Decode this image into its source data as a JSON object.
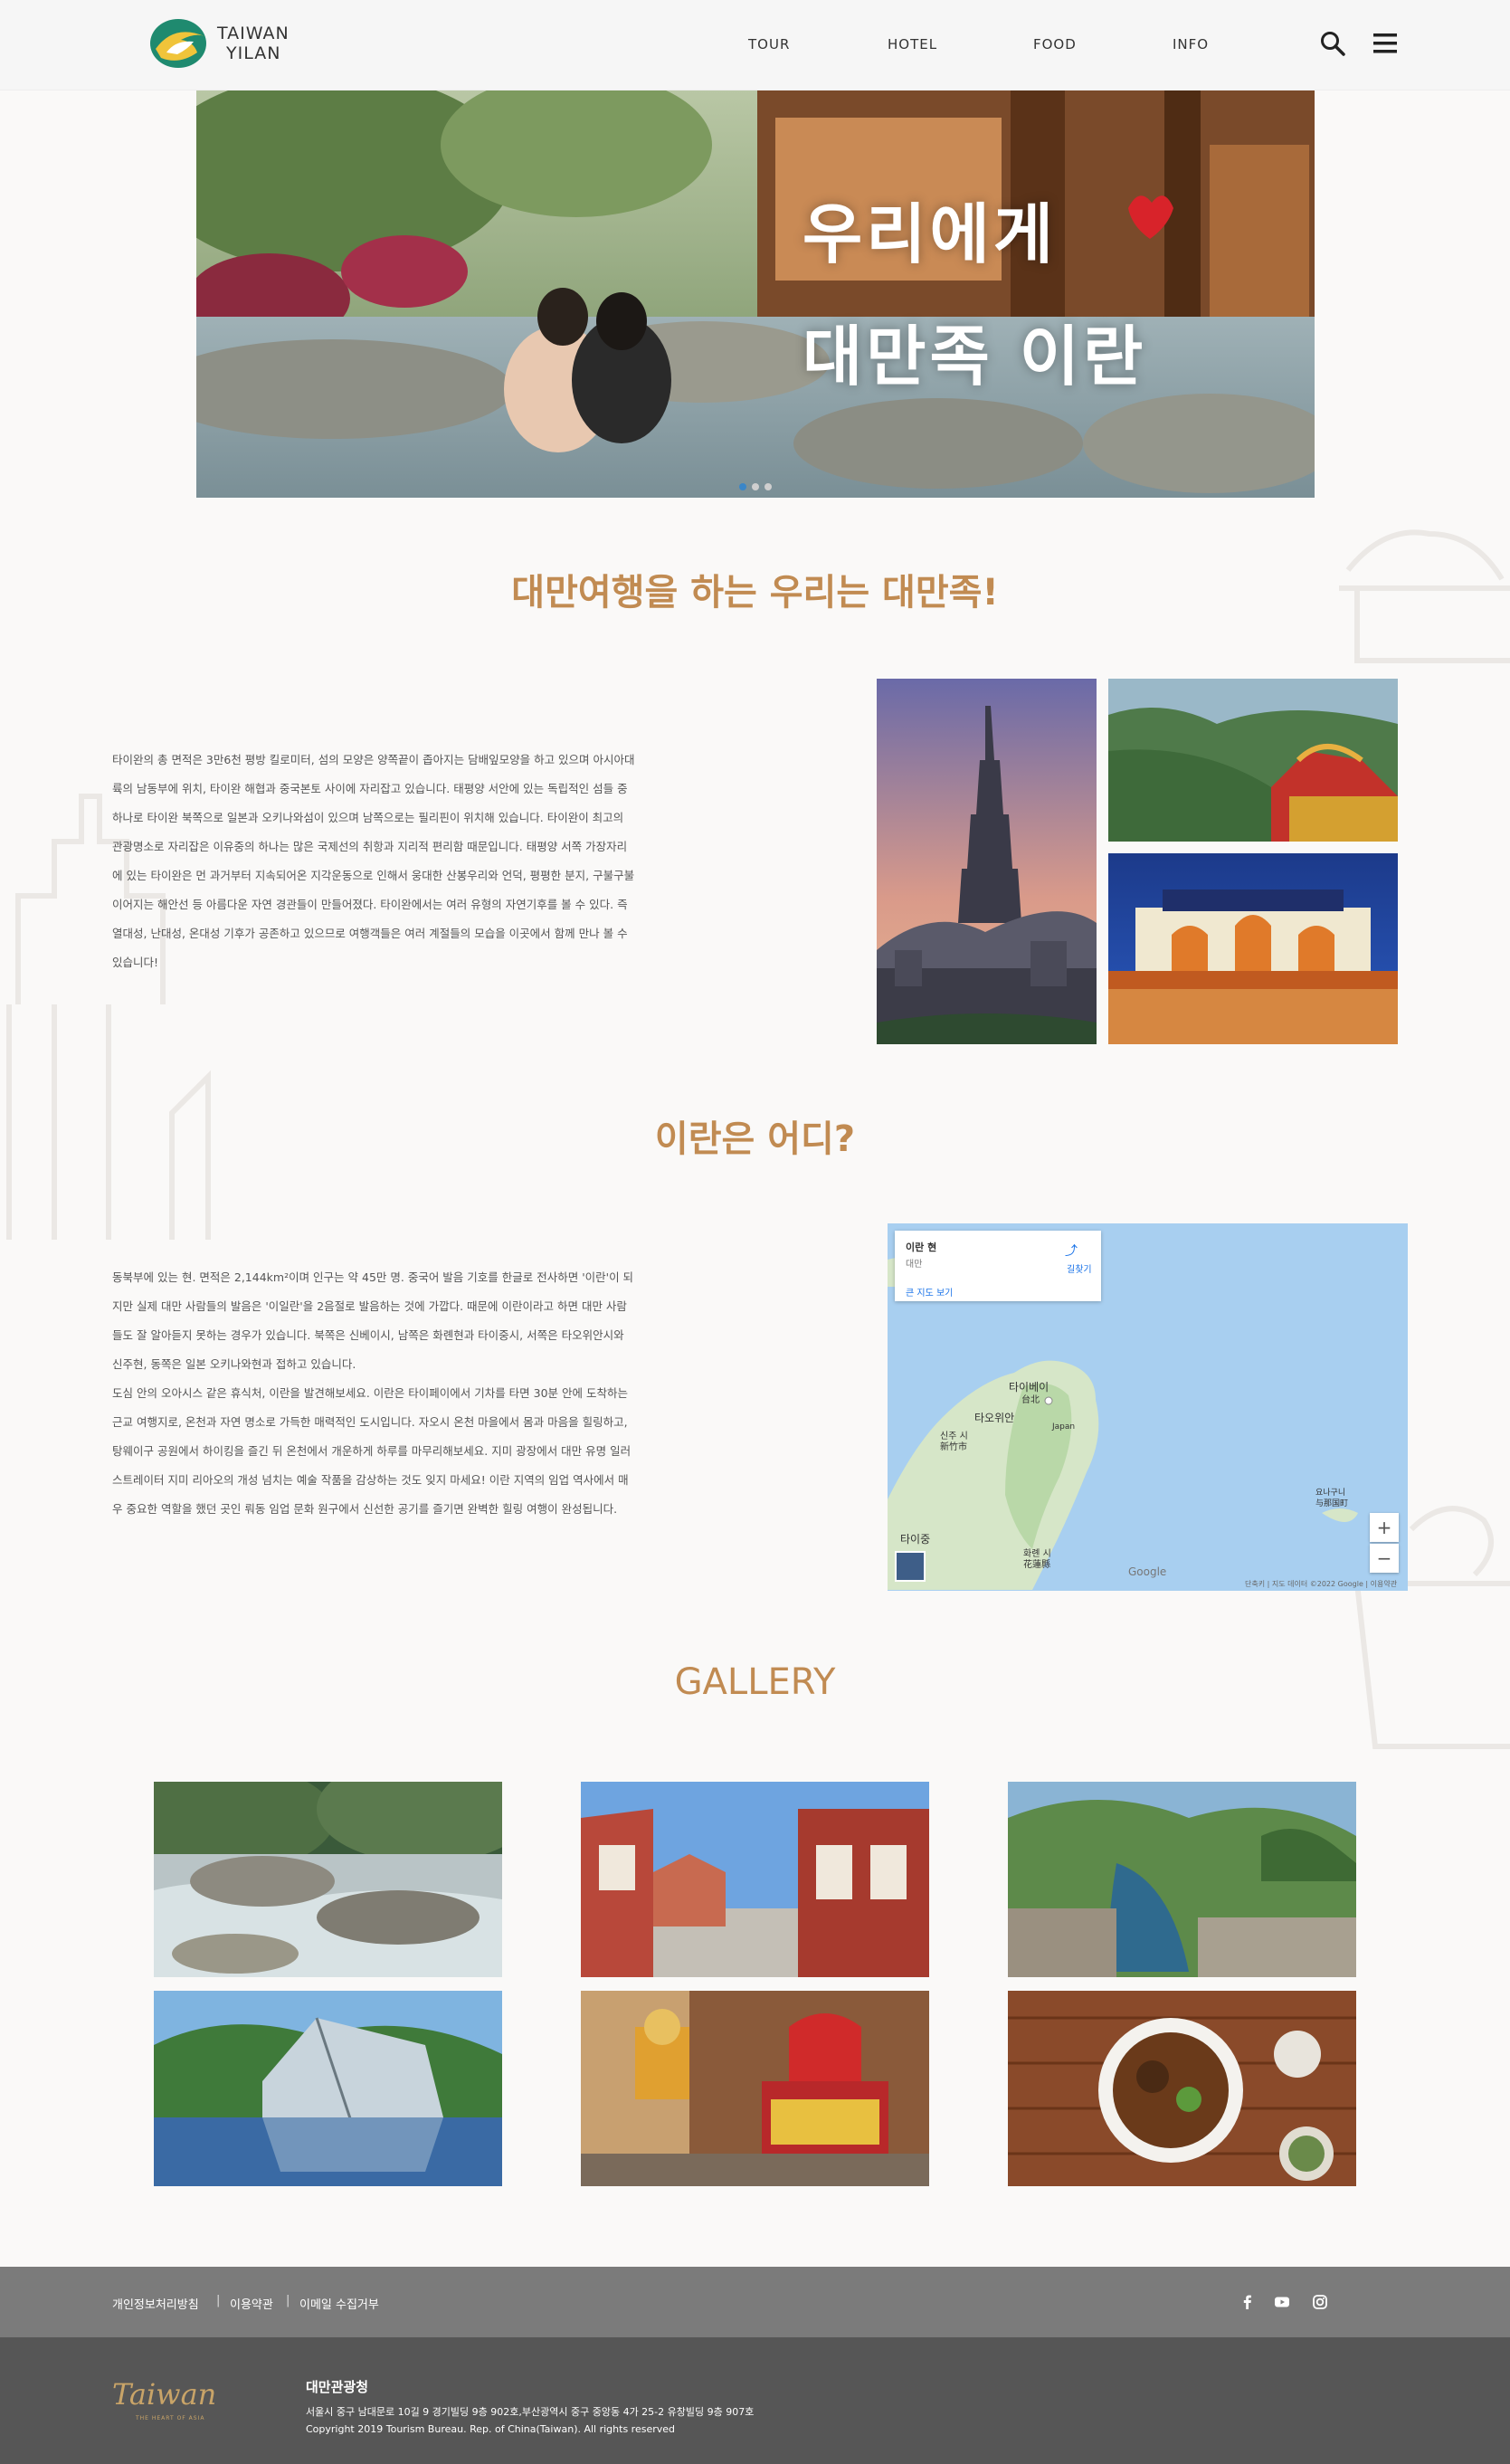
{
  "header": {
    "logo_line1": "TAIWAN",
    "logo_line2": "YILAN",
    "nav": [
      "TOUR",
      "HOTEL",
      "FOOD",
      "INFO"
    ]
  },
  "hero": {
    "line1": "우리에게",
    "line2": "대만족 이란"
  },
  "section1": {
    "title": "대만여행을 하는 우리는 대만족!",
    "paragraph": "타이완의 총 면적은 3만6천 평방 킬로미터, 섬의 모양은 양쪽끝이 좁아지는 담배잎모양을 하고 있으며 아시아대륙의 남동부에 위치, 타이완 해협과 중국본토 사이에 자리잡고 있습니다. 태평양 서안에 있는 독립적인 섬들 중 하나로 타이완 북쪽으로 일본과 오키나와섬이 있으며 남쪽으로는 필리핀이 위치해 있습니다. 타이완이 최고의 관광명소로 자리잡은 이유중의 하나는 많은 국제선의 취항과 지리적 편리함 때문입니다. 태평양 서쪽 가장자리에 있는 타이완은 먼 과거부터 지속되어온 지각운동으로 인해서 웅대한 산봉우리와 언덕, 평평한 분지, 구불구불 이어지는 해안선 등 아름다운 자연 경관들이 만들어졌다. 타이완에서는 여러 유형의 자연기후를 볼 수 있다. 즉 열대성, 난대성, 온대성 기후가 공존하고 있으므로 여행객들은 여러 계절들의 모습을 이곳에서 함께 만나 볼 수 있습니다!"
  },
  "section2": {
    "title": "이란은 어디?",
    "paragraph1": "동북부에 있는 현. 면적은 2,144km²이며 인구는 약 45만 명. 중국어 발음 기호를 한글로 전사하면 '이란'이 되지만 실제 대만 사람들의 발음은 '이일란'을 2음절로 발음하는 것에 가깝다. 때문에 이란이라고 하면 대만 사람들도 잘 알아듣지 못하는 경우가 있습니다. 북쪽은 신베이시, 남쪽은 화롄현과 타이중시, 서쪽은 타오위안시와 신주현, 동쪽은 일본 오키나와현과 접하고 있습니다.",
    "paragraph2": "도심 안의 오아시스 같은 휴식처, 이란을 발견해보세요. 이란은 타이페이에서 기차를 타면 30분 안에 도착하는 근교 여행지로, 온천과 자연 명소로 가득한 매력적인 도시입니다. 자오시 온천 마을에서 몸과 마음을 힐링하고, 탕웨이구 공원에서 하이킹을 즐긴 뒤 온천에서 개운하게 하루를 마무리해보세요. 지미 광장에서 대만 유명 일러스트레이터 지미 리아오의 개성 넘치는 예술 작품을 감상하는 것도 잊지 마세요! 이란 지역의 임업 역사에서 매우 중요한 역할을 했던 곳인 뤄동 임업 문화 원구에서 신선한 공기를 즐기면 완벽한 힐링 여행이 완성됩니다."
  },
  "map": {
    "card_title": "이란 현",
    "card_sub": "대만",
    "directions": "길찾기",
    "larger_map": "큰 지도 보기",
    "labels": {
      "taipei_ko": "타이베이",
      "taipei_zh": "台北",
      "taoyuan": "타오위안",
      "xinzhu_ko": "신주 시",
      "xinzhu_zh": "新竹市",
      "taizhong": "타이중",
      "hualien_ko": "화롄 시",
      "hualien_zh": "花蓮縣",
      "japan": "Japan",
      "yonaguni_ko": "요나구니",
      "yonaguni_zh": "与那国町",
      "google": "Google",
      "footer": "단축키 | 지도 데이터 ©2022 Google | 이용약관"
    }
  },
  "gallery": {
    "title": "GALLERY"
  },
  "footer": {
    "links": [
      "개인정보처리방침",
      "이용약관",
      "이메일 수집거부"
    ],
    "brand": "Taiwan",
    "brand_sub": "THE HEART OF ASIA",
    "org": "대만관광청",
    "address": "서울시 중구 남대문로 10길 9 경기빌딩 9층 902호,부산광역시 중구 중앙동 4가 25-2 유창빌딩 9층 907호",
    "copyright": "Copyright 2019 Tourism Bureau. Rep. of China(Taiwan). All rights reserved"
  },
  "colors": {
    "accent": "#c18b52",
    "footer_top": "#7b7b7b",
    "footer_bottom": "#565656"
  }
}
